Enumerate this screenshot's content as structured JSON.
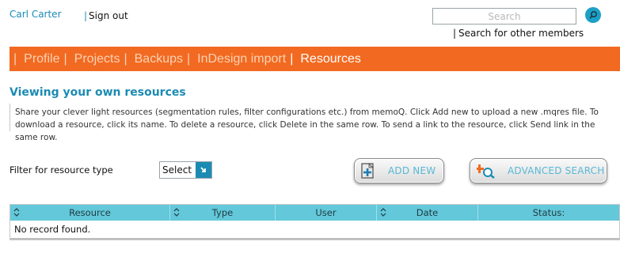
{
  "header": {
    "user_name": "Carl Carter",
    "sign_out": "Sign out",
    "search_placeholder": "Search",
    "search_other": "Search for other members",
    "accent_color": "#1b8bb3"
  },
  "nav": {
    "bg_color": "#f26a21",
    "items": [
      {
        "label": "Profile",
        "active": false
      },
      {
        "label": "Projects",
        "active": false
      },
      {
        "label": "Backups",
        "active": false
      },
      {
        "label": "InDesign import",
        "active": false
      },
      {
        "label": "Resources",
        "active": true
      }
    ]
  },
  "page": {
    "title": "Viewing your own resources",
    "description": "Share your clever light resources (segmentation rules, filter configurations etc.) from memoQ. Click Add new to upload a new .mqres file. To download a resource, click its name. To delete a resource, click Delete in the same row. To send a link to the resource, click Send link in the same row."
  },
  "filter": {
    "label": "Filter for resource type",
    "selected": "Select"
  },
  "buttons": {
    "add_new": "ADD NEW",
    "advanced_search": "ADVANCED SEARCH"
  },
  "table": {
    "columns": [
      "Resource",
      "Type",
      "User",
      "Date",
      "Status:"
    ],
    "sortable": [
      true,
      true,
      false,
      true,
      false
    ],
    "empty_text": "No record found.",
    "header_color": "#63c8d9"
  }
}
